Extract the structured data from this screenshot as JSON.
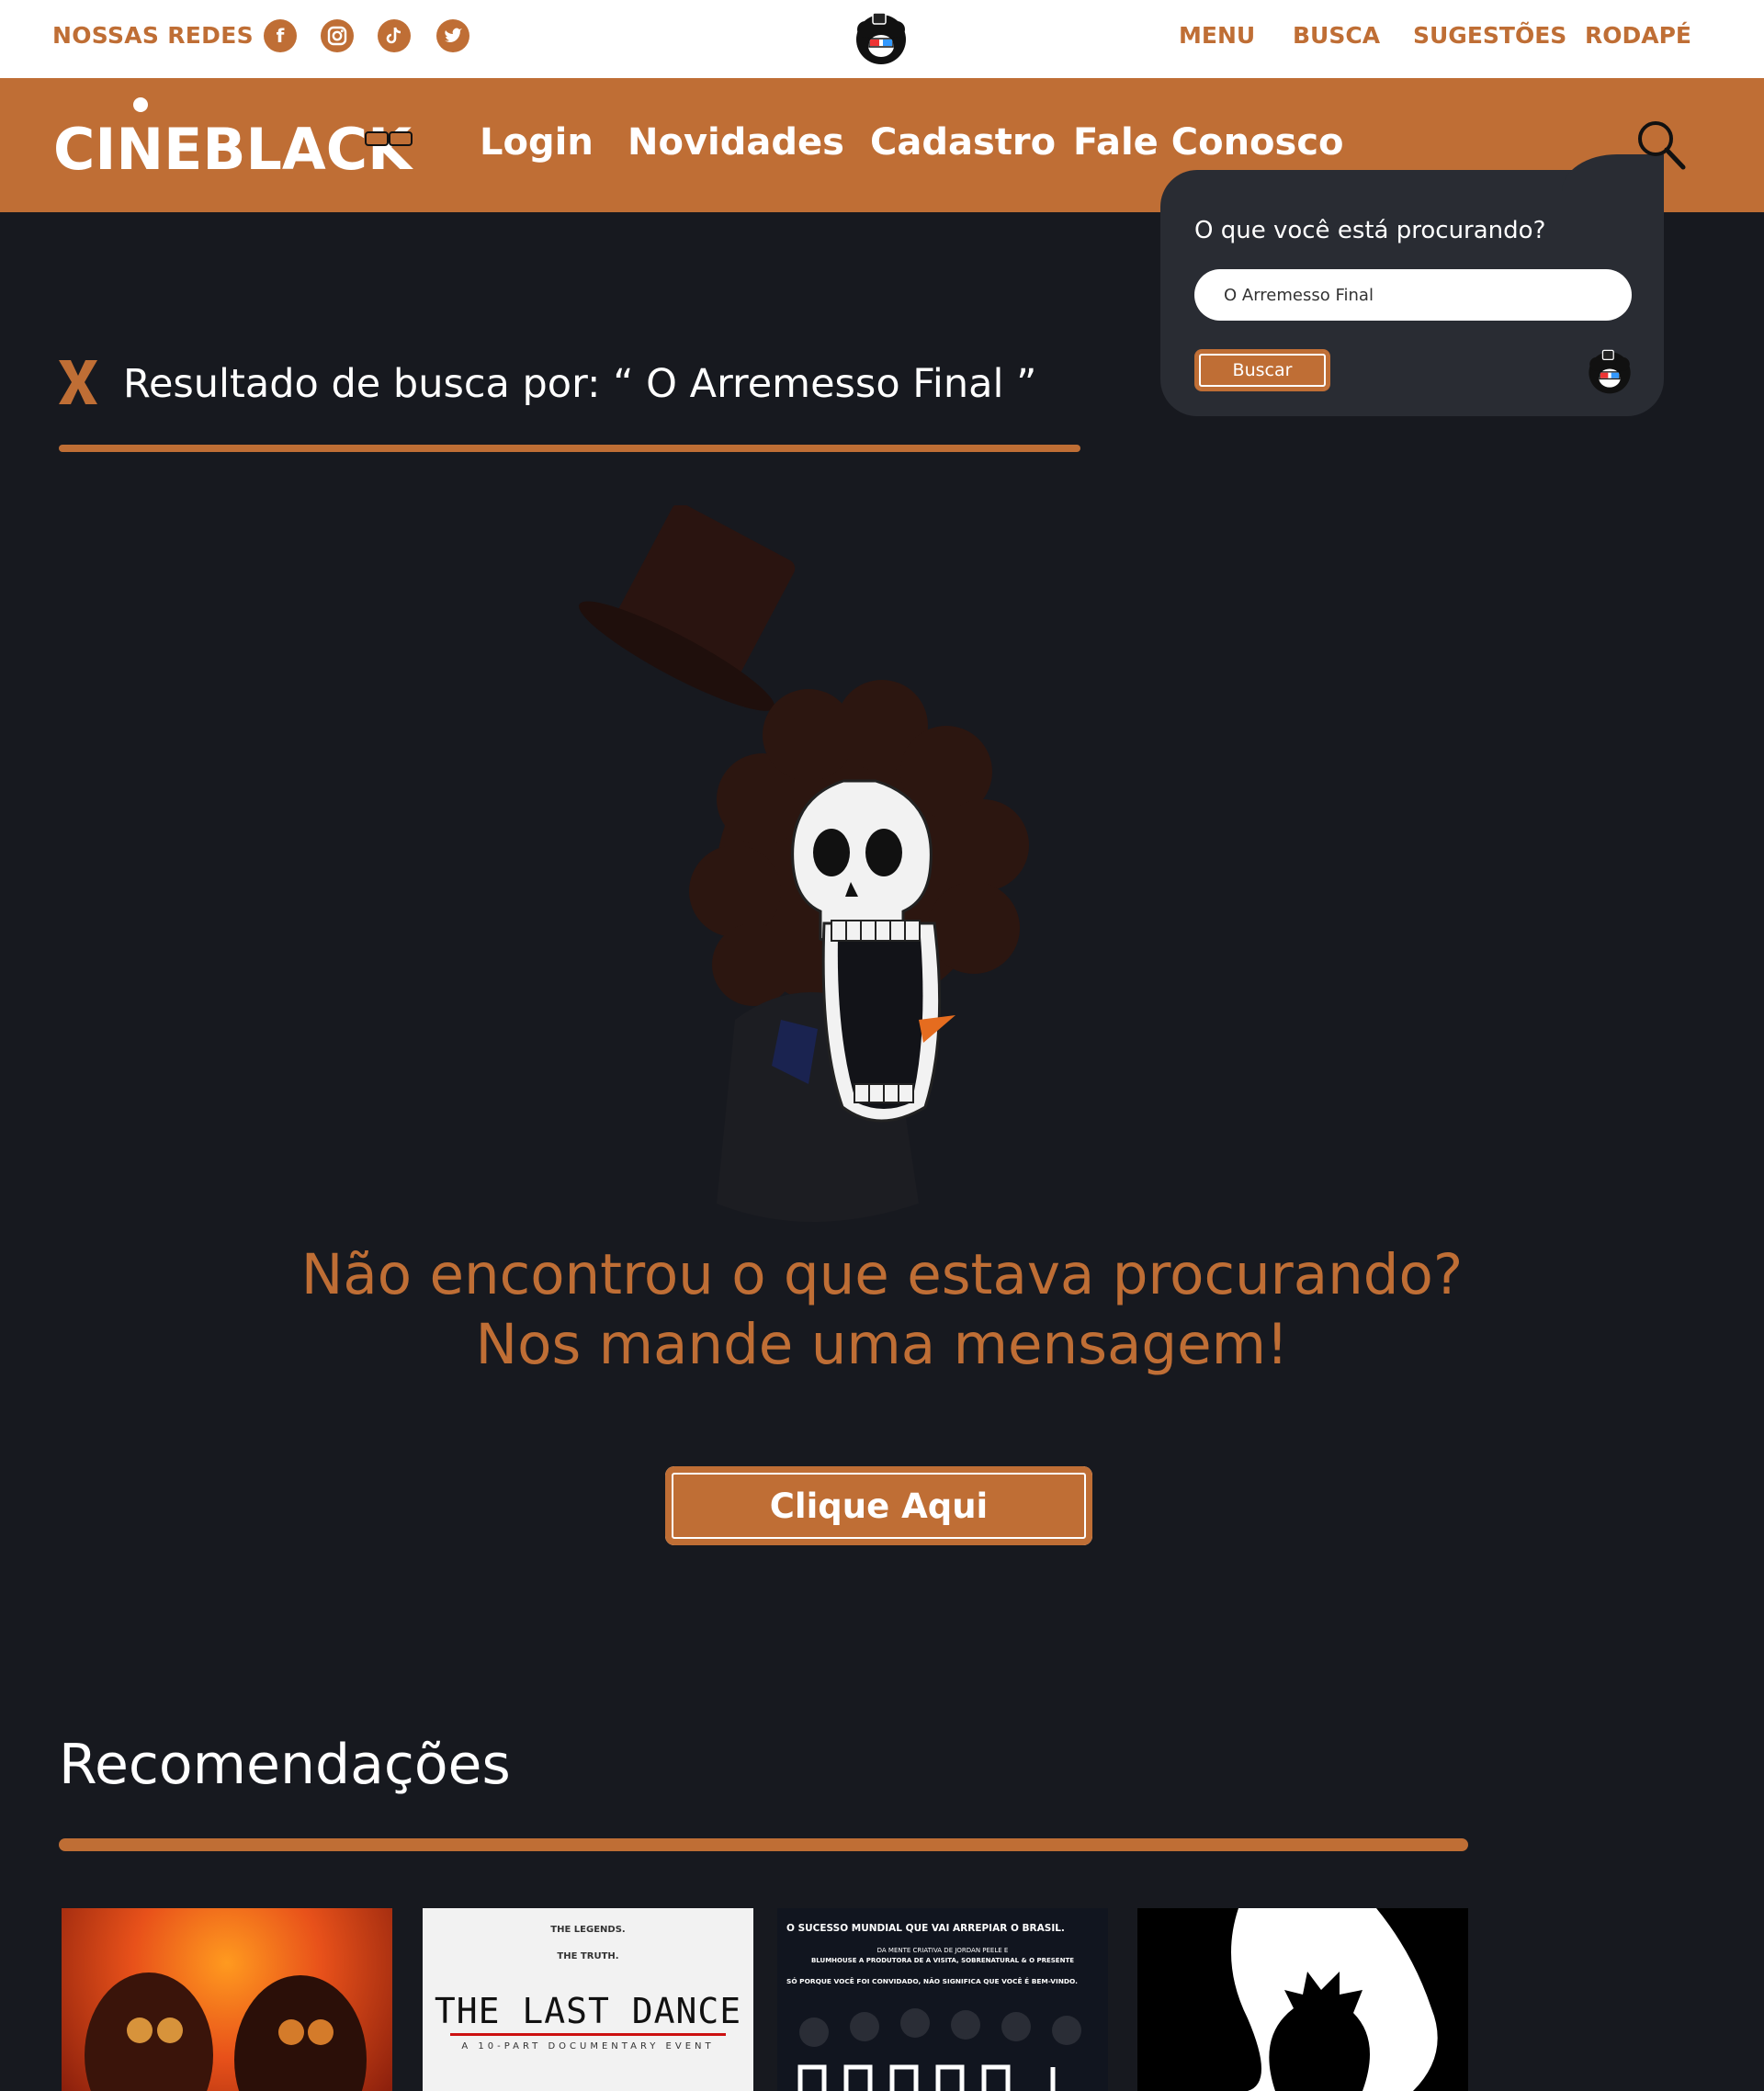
{
  "topbar": {
    "redes_label": "NOSSAS REDES",
    "social": [
      "facebook-icon",
      "instagram-icon",
      "tiktok-icon",
      "twitter-icon"
    ],
    "nav": [
      "MENU",
      "BUSCA",
      "SUGESTÕES",
      "RODAPÉ"
    ]
  },
  "header": {
    "logo_text": "CINEBLACK",
    "nav": [
      "Login",
      "Novidades",
      "Cadastro",
      "Fale Conosco"
    ]
  },
  "search": {
    "question": "O que você está procurando?",
    "value": "O Arremesso Final",
    "button": "Buscar"
  },
  "results": {
    "title": "Resultado de busca por: “ O Arremesso Final ”"
  },
  "notfound": {
    "line1": "Não encontrou o que estava procurando?",
    "line2": "Nos mande uma mensagem!",
    "cta": "Clique Aqui"
  },
  "recommendations": {
    "title": "Recomendações",
    "posters": [
      {
        "lines": []
      },
      {
        "lines": [
          "THE LEGENDS.",
          "THE TRUTH.",
          "THE LAST DANCE",
          "A 10-PART DOCUMENTARY EVENT"
        ]
      },
      {
        "lines": [
          "O SUCESSO MUNDIAL QUE VAI ARREPIAR O BRASIL.",
          "DA MENTE CRIATIVA DE JORDAN PEELE E",
          "BLUMHOUSE A PRODUTORA DE A VISITA, SOBRENATURAL & O PRESENTE",
          "SÓ PORQUE VOCÊ FOI CONVIDADO, NÃO SIGNIFICA QUE VOCÊ É BEM-VINDO."
        ]
      },
      {
        "lines": []
      }
    ]
  },
  "colors": {
    "accent": "#bf6e35",
    "background": "#17191f",
    "panel": "#292c33"
  }
}
